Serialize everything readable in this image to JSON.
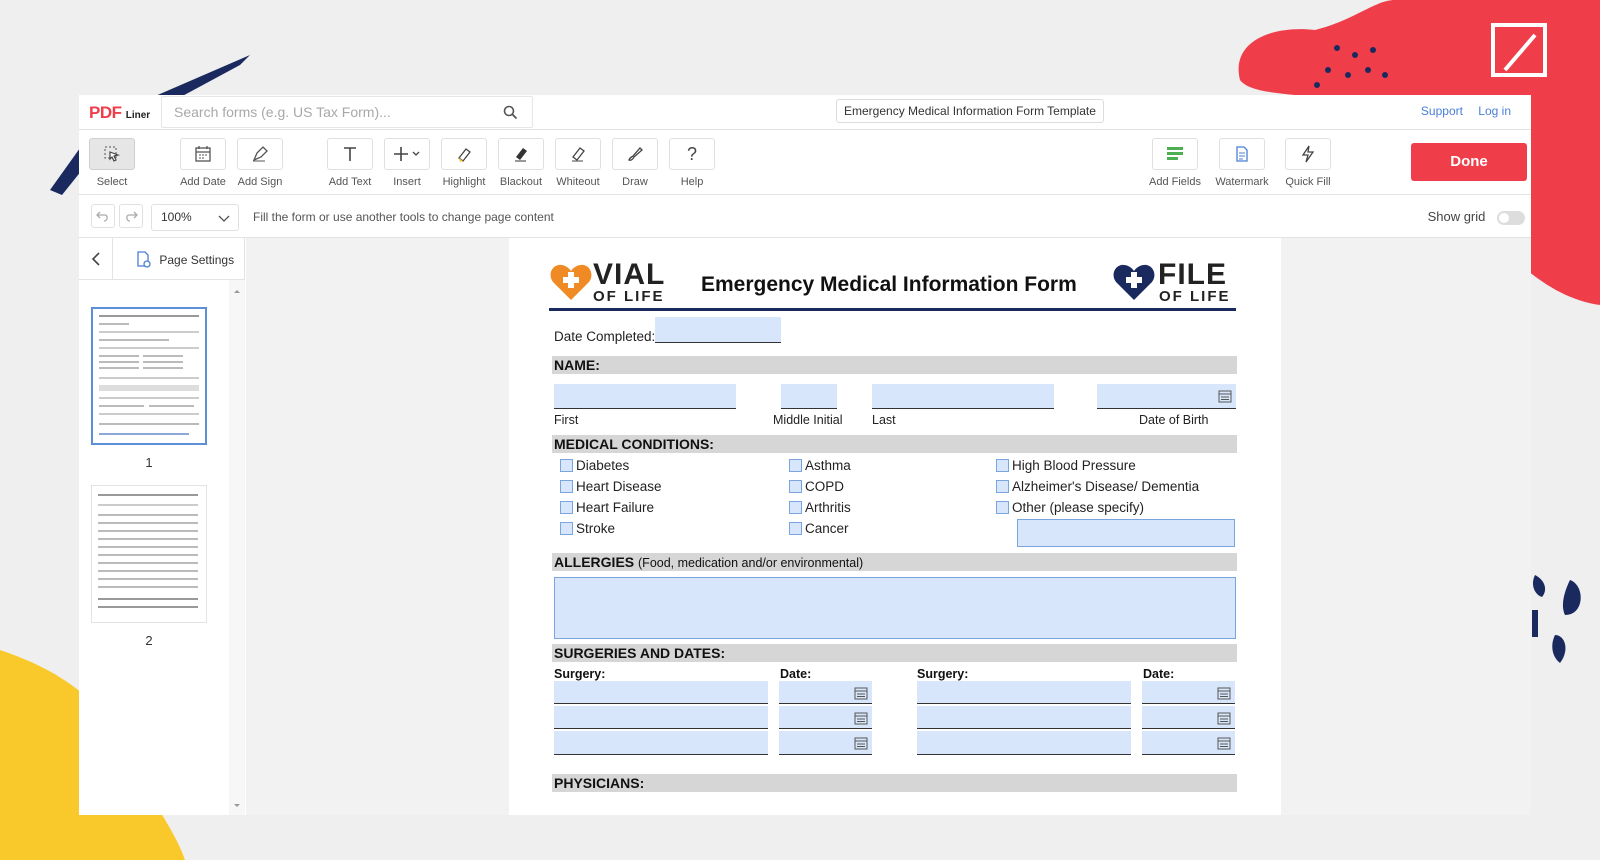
{
  "app": {
    "logo_pdf": "PDF",
    "logo_liner": "Liner",
    "search_placeholder": "Search forms (e.g. US Tax Form)...",
    "doc_title": "Emergency Medical Information Form Template",
    "support": "Support",
    "login": "Log in"
  },
  "toolbar": {
    "select": "Select",
    "add_date": "Add Date",
    "add_sign": "Add Sign",
    "add_text": "Add Text",
    "insert": "Insert",
    "highlight": "Highlight",
    "blackout": "Blackout",
    "whiteout": "Whiteout",
    "draw": "Draw",
    "help": "Help",
    "add_fields": "Add Fields",
    "watermark": "Watermark",
    "quick_fill": "Quick Fill",
    "done": "Done"
  },
  "subbar": {
    "zoom": "100%",
    "hint": "Fill the form or use another tools to change page content",
    "show_grid": "Show grid"
  },
  "sidebar": {
    "page_settings": "Page Settings",
    "pages": [
      "1",
      "2"
    ]
  },
  "form": {
    "title": "Emergency Medical Information Form",
    "vial_big": "VIAL",
    "vial_small": "OF LIFE",
    "file_big": "FILE",
    "file_small": "OF LIFE",
    "date_completed": "Date Completed:",
    "name_header": "NAME:",
    "first": "First",
    "middle": "Middle Initial",
    "last": "Last",
    "dob": "Date of Birth",
    "conditions_header": "MEDICAL CONDITIONS:",
    "conditions": {
      "col1": [
        "Diabetes",
        "Heart Disease",
        "Heart Failure",
        "Stroke"
      ],
      "col2": [
        "Asthma",
        "COPD",
        "Arthritis",
        "Cancer"
      ],
      "col3": [
        "High Blood Pressure",
        "Alzheimer's Disease/ Dementia",
        "Other (please specify)"
      ]
    },
    "allergies_header": "ALLERGIES",
    "allergies_sub": "(Food, medication and/or environmental)",
    "surgeries_header": "SURGERIES AND DATES:",
    "surgery": "Surgery:",
    "date": "Date:",
    "physicians_header": "PHYSICIANS:"
  },
  "colors": {
    "accent": "#ef3e4a",
    "field_bg": "#d7e6fb",
    "link": "#4a7fd6",
    "navy": "#1b2a5e",
    "orange": "#f08a24"
  }
}
